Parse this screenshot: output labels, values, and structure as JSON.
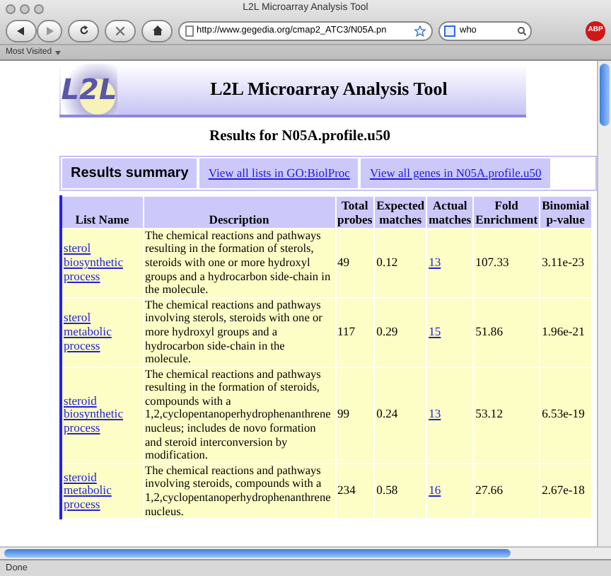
{
  "window": {
    "title": "L2L Microarray Analysis Tool"
  },
  "toolbar": {
    "url": "http://www.gegedia.org/cmap2_ATC3/N05A.pn",
    "search_value": "who",
    "addon_badge": "ABP"
  },
  "bookmarks_bar": {
    "items": [
      "Most Visited"
    ]
  },
  "page": {
    "logo_text": "L2L",
    "banner_title": "L2L Microarray Analysis Tool",
    "results_heading": "Results for N05A.profile.u50",
    "tabs": [
      {
        "label": "Results summary",
        "selected": true
      },
      {
        "label": "View all lists in GO:BiolProc",
        "selected": false
      },
      {
        "label": "View all genes in N05A.profile.u50",
        "selected": false
      }
    ],
    "table": {
      "columns": [
        "List Name",
        "Description",
        "Total probes",
        "Expected matches",
        "Actual matches",
        "Fold Enrichment",
        "Binomial p-value"
      ],
      "rows": [
        {
          "list_name": "sterol biosynthetic process",
          "description": "The chemical reactions and pathways resulting in the formation of sterols, steroids with one or more hydroxyl groups and a hydrocarbon side-chain in the molecule.",
          "total_probes": "49",
          "expected_matches": "0.12",
          "actual_matches": "13",
          "fold_enrichment": "107.33",
          "p_value": "3.11e-23"
        },
        {
          "list_name": "sterol metabolic process",
          "description": "The chemical reactions and pathways involving sterols, steroids with one or more hydroxyl groups and a hydrocarbon side-chain in the molecule.",
          "total_probes": "117",
          "expected_matches": "0.29",
          "actual_matches": "15",
          "fold_enrichment": "51.86",
          "p_value": "1.96e-21"
        },
        {
          "list_name": "steroid biosynthetic process",
          "description": "The chemical reactions and pathways resulting in the formation of steroids, compounds with a 1,2,cyclopentanoperhydrophenanthrene nucleus; includes de novo formation and steroid interconversion by modification.",
          "total_probes": "99",
          "expected_matches": "0.24",
          "actual_matches": "13",
          "fold_enrichment": "53.12",
          "p_value": "6.53e-19"
        },
        {
          "list_name": "steroid metabolic process",
          "description": "The chemical reactions and pathways involving steroids, compounds with a 1,2,cyclopentanoperhydrophenanthrene nucleus.",
          "total_probes": "234",
          "expected_matches": "0.58",
          "actual_matches": "16",
          "fold_enrichment": "27.66",
          "p_value": "2.67e-18"
        }
      ]
    }
  },
  "status_bar": {
    "text": "Done"
  }
}
